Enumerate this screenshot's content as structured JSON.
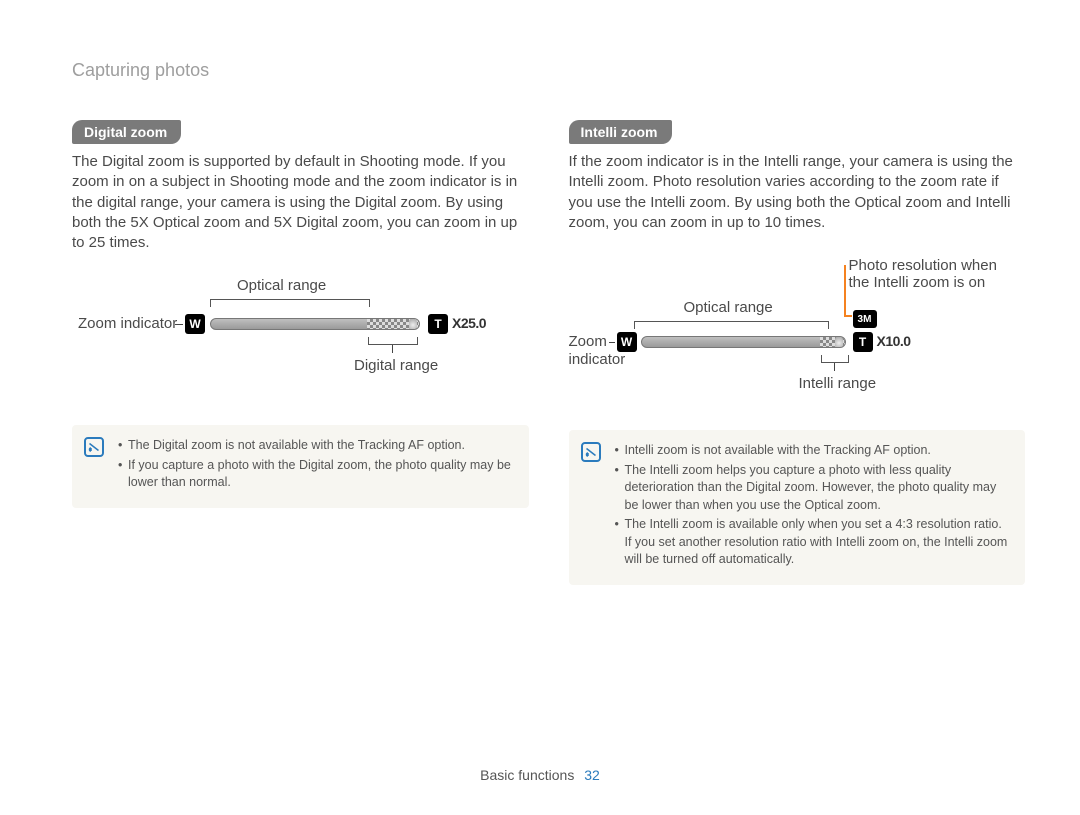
{
  "breadcrumb": "Capturing photos",
  "left": {
    "title": "Digital zoom",
    "body": "The Digital zoom is supported by default in Shooting mode. If you zoom in on a subject in Shooting mode and the zoom indicator is in the digital range, your camera is using the Digital zoom. By using both the 5X Optical zoom and 5X Digital zoom, you can zoom in up to 25 times.",
    "diagram": {
      "optical_label": "Optical range",
      "digital_label": "Digital range",
      "zoom_indicator_label": "Zoom indicator",
      "w_icon": "W",
      "t_icon": "T",
      "zoom_value": "X25.0"
    },
    "notes": [
      "The Digital zoom is not available with the Tracking AF option.",
      "If you capture a photo with the Digital zoom, the photo quality may be lower than normal."
    ]
  },
  "right": {
    "title": "Intelli zoom",
    "body": "If the zoom indicator is in the Intelli range, your camera is using the Intelli zoom. Photo resolution varies according to the zoom rate if you use the Intelli zoom. By using both the Optical zoom and Intelli zoom, you can zoom in up to 10 times.",
    "diagram": {
      "optical_label": "Optical range",
      "intelli_label": "Intelli range",
      "zoom_indicator_label": "Zoom",
      "zoom_indicator_label2": "indicator",
      "res_label": "Photo resolution when the Intelli zoom is on",
      "w_icon": "W",
      "t_icon": "T",
      "res_icon": "3M",
      "zoom_value": "X10.0"
    },
    "notes": [
      "Intelli zoom is not available with the Tracking AF option.",
      "The Intelli zoom helps you capture a photo with less quality deterioration than the Digital zoom. However, the photo quality may be lower than when you use the Optical zoom.",
      "The Intelli zoom is available only when you set a 4:3 resolution ratio. If you set another resolution ratio with Intelli zoom on, the Intelli zoom will be turned off automatically."
    ]
  },
  "footer": {
    "section": "Basic functions",
    "page": "32"
  }
}
